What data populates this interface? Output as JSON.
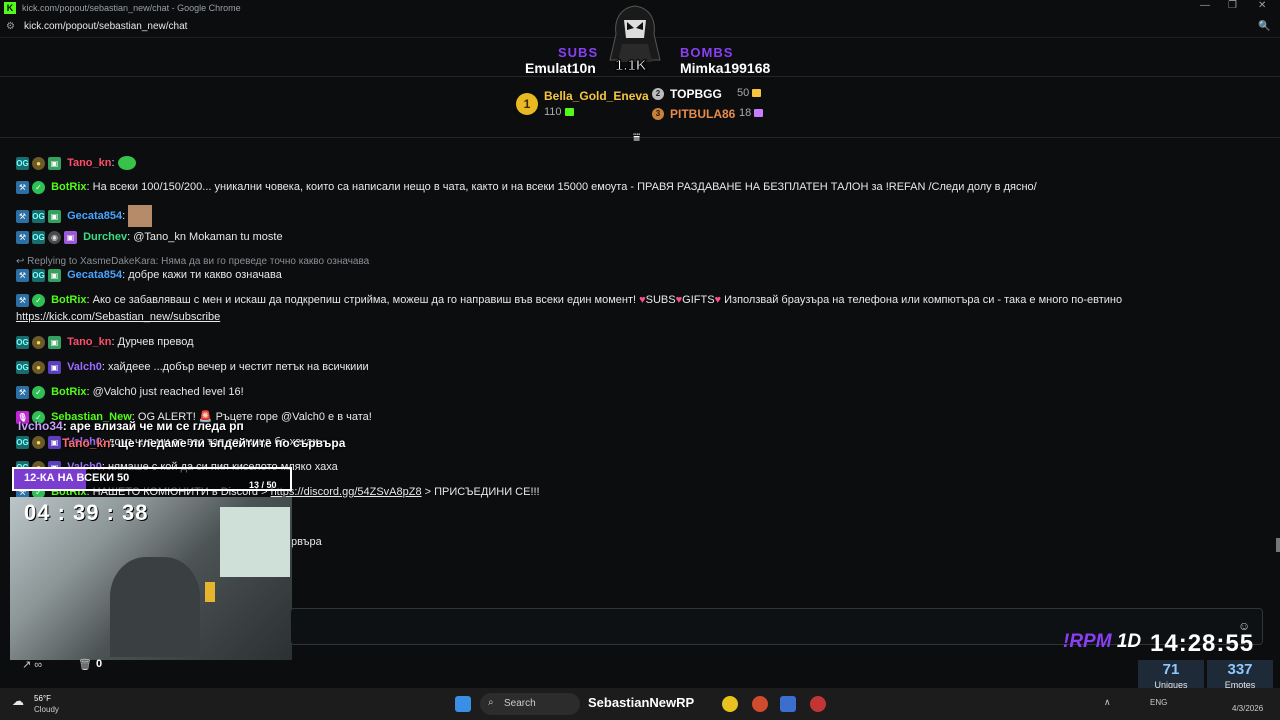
{
  "window": {
    "title": "kick.com/popout/sebastian_new/chat - Google Chrome",
    "url": "kick.com/popout/sebastian_new/chat"
  },
  "top": {
    "subs_label": "SUBS",
    "subs_name": "Emulat10n",
    "bombs_label": "BOMBS",
    "bombs_name": "Mimka199168",
    "mascot_count": "1.1K"
  },
  "leaderboard": {
    "first": {
      "rank": "1",
      "name": "Bella_Gold_Eneva",
      "score": "110"
    },
    "second": {
      "rank": "2",
      "name": "TOPBGG",
      "score": "50"
    },
    "third": {
      "rank": "3",
      "name": "PITBULA86",
      "score": "18"
    }
  },
  "chat": {
    "m1": {
      "user": "Tano_kn",
      "text": ""
    },
    "m2": {
      "user": "BotRix",
      "text": "На всеки 100/150/200... уникални човека, които са написали нещо в чата, както и на всеки 15000 емоута - ПРАВЯ РАЗДАВАНЕ НА БЕЗПЛАТЕН ТАЛОН за !REFAN /Следи долу в дясно/"
    },
    "m3": {
      "user": "Gecata854",
      "text": ""
    },
    "m4": {
      "user": "Durchev",
      "text": "@Tano_kn Mokaman tu moste"
    },
    "m5": {
      "reply": "Replying to XasmeDakeKara: Няма да ви го преведе точно какво означава",
      "user": "Gecata854",
      "text": "добре кажи ти какво означава"
    },
    "m6": {
      "user": "BotRix",
      "text": "Ако се забавляваш с мен и искаш да подкрепиш стрийма, можеш да го направиш във всеки един момент!",
      "subs": "SUBS",
      "gifts": "GIFTS",
      "text2": "Използвай браузъра на телефона или компютъра си - така е много по-евтино",
      "link": "https://kick.com/Sebastian_new/subscribe"
    },
    "m7": {
      "user": "Tano_kn",
      "text": "Дурчев превод"
    },
    "m8": {
      "user": "Valch0",
      "text": "хайдеее ...добър вечер и честит петък на всичкиии"
    },
    "m9": {
      "user": "BotRix",
      "text": "@Valch0 just reached level 16!"
    },
    "m10": {
      "user": "Sebastian_New",
      "text": "OG ALERT!",
      "text2": "Ръцете горе @Valch0 е в чата!"
    },
    "m11": {
      "user": "Valch0",
      "text": "домъчня ми за вас тая седмица бе хахах"
    },
    "m12": {
      "user": "Valch0",
      "text": "нямаше с кой да си пия киселото мляко хаха"
    },
    "m13": {
      "user": "BotRix",
      "text": "НАШЕТО КОМЮНИТИ в Discord >",
      "link": "https://discord.gg/54ZSvA8pZ8",
      "text2": "> ПРИСЪЕДИНИ СЕ!!!"
    },
    "m14": {
      "text": "рвъра"
    }
  },
  "overlay": {
    "line1_user": "Ivcho34",
    "line1_text": ": аре влизай че ми се гледа рп",
    "line2_user": "Tano_kn",
    "line2_text": ": ще гледаме ли ъпдейтите по сървъра",
    "goal_label": "12-КА НА ВСЕКИ 50",
    "goal_progress": "13 / 50",
    "goal_fraction": 0.26,
    "timer": "04 : 39 : 38"
  },
  "stream_bottom": {
    "rpm": "!RPM",
    "duration": "1D",
    "clock": "14:28:55",
    "uniques_value": "71",
    "uniques_label": "Uniques",
    "emotes_value": "337",
    "emotes_label": "Emotes",
    "left_count": "0"
  },
  "taskbar": {
    "weather_temp": "56°F",
    "weather_desc": "Cloudy",
    "search": "Search",
    "overlay_name": "SebastianNewRP",
    "lang": "ENG",
    "date": "4/3/2026"
  }
}
